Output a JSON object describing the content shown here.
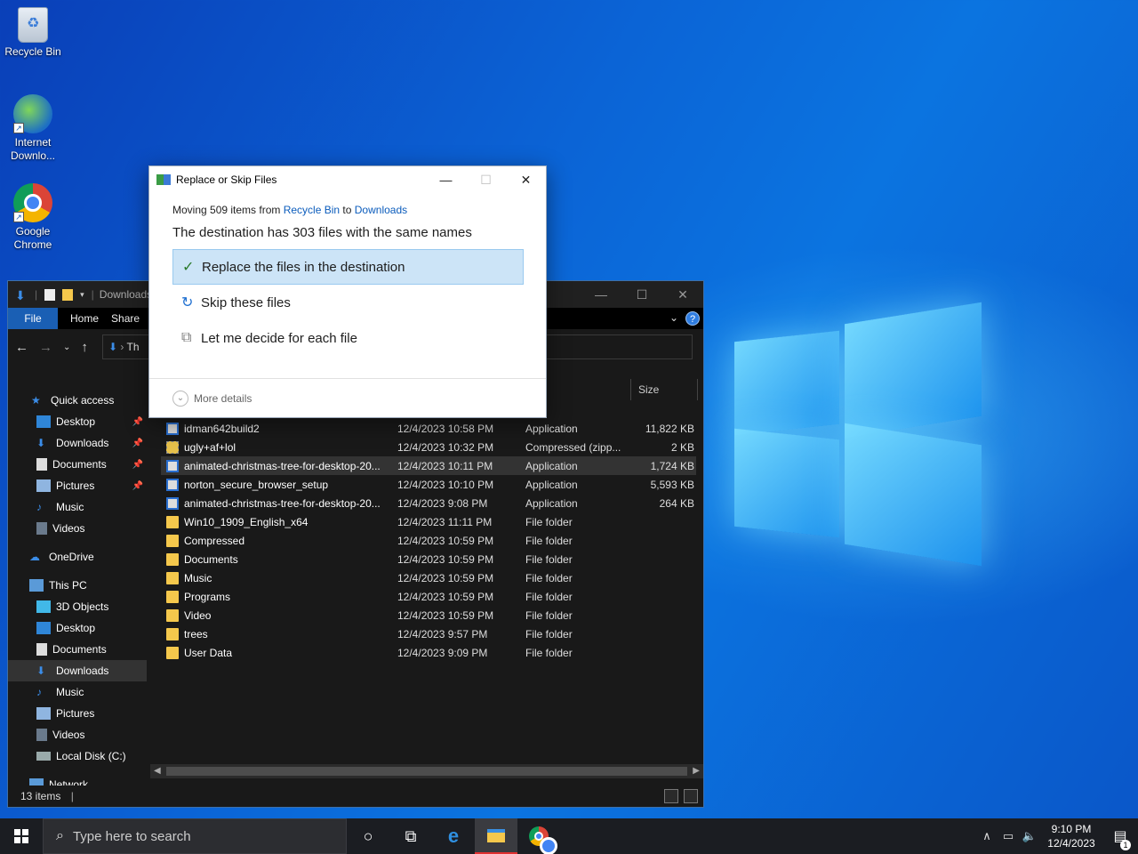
{
  "desktop": {
    "icons": [
      {
        "label": "Recycle Bin"
      },
      {
        "label": "Internet Downlo..."
      },
      {
        "label": "Google Chrome"
      }
    ]
  },
  "explorer": {
    "title": "Downloads",
    "ribbon": {
      "file": "File",
      "home": "Home",
      "share": "Share",
      "help": "?"
    },
    "address_partial": "Th",
    "column_size": "Size",
    "nav": [
      {
        "label": "Quick access"
      },
      {
        "label": "Desktop",
        "pinned": true
      },
      {
        "label": "Downloads",
        "pinned": true
      },
      {
        "label": "Documents",
        "pinned": true
      },
      {
        "label": "Pictures",
        "pinned": true
      },
      {
        "label": "Music"
      },
      {
        "label": "Videos"
      },
      {
        "label": "OneDrive"
      },
      {
        "label": "This PC"
      },
      {
        "label": "3D Objects"
      },
      {
        "label": "Desktop"
      },
      {
        "label": "Documents"
      },
      {
        "label": "Downloads"
      },
      {
        "label": "Music"
      },
      {
        "label": "Pictures"
      },
      {
        "label": "Videos"
      },
      {
        "label": "Local Disk (C:)"
      },
      {
        "label": "Network"
      }
    ],
    "files": [
      {
        "name": "idman642build2",
        "date": "12/4/2023 10:58 PM",
        "type": "Application",
        "size": "11,822 KB",
        "kind": "app"
      },
      {
        "name": "ugly+af+lol",
        "date": "12/4/2023 10:32 PM",
        "type": "Compressed (zipp...",
        "size": "2 KB",
        "kind": "zip"
      },
      {
        "name": "animated-christmas-tree-for-desktop-20...",
        "date": "12/4/2023 10:11 PM",
        "type": "Application",
        "size": "1,724 KB",
        "kind": "app"
      },
      {
        "name": "norton_secure_browser_setup",
        "date": "12/4/2023 10:10 PM",
        "type": "Application",
        "size": "5,593 KB",
        "kind": "app"
      },
      {
        "name": "animated-christmas-tree-for-desktop-20...",
        "date": "12/4/2023 9:08 PM",
        "type": "Application",
        "size": "264 KB",
        "kind": "app"
      },
      {
        "name": "Win10_1909_English_x64",
        "date": "12/4/2023 11:11 PM",
        "type": "File folder",
        "size": "",
        "kind": "folder"
      },
      {
        "name": "Compressed",
        "date": "12/4/2023 10:59 PM",
        "type": "File folder",
        "size": "",
        "kind": "folder"
      },
      {
        "name": "Documents",
        "date": "12/4/2023 10:59 PM",
        "type": "File folder",
        "size": "",
        "kind": "folder"
      },
      {
        "name": "Music",
        "date": "12/4/2023 10:59 PM",
        "type": "File folder",
        "size": "",
        "kind": "folder"
      },
      {
        "name": "Programs",
        "date": "12/4/2023 10:59 PM",
        "type": "File folder",
        "size": "",
        "kind": "folder"
      },
      {
        "name": "Video",
        "date": "12/4/2023 10:59 PM",
        "type": "File folder",
        "size": "",
        "kind": "folder"
      },
      {
        "name": "trees",
        "date": "12/4/2023 9:57 PM",
        "type": "File folder",
        "size": "",
        "kind": "folder"
      },
      {
        "name": "User Data",
        "date": "12/4/2023 9:09 PM",
        "type": "File folder",
        "size": "",
        "kind": "folder"
      }
    ],
    "status": "13 items"
  },
  "dialog": {
    "title": "Replace or Skip Files",
    "moving_prefix": "Moving 509 items from ",
    "source": "Recycle Bin",
    "to": " to ",
    "dest": "Downloads",
    "message": "The destination has 303 files with the same names",
    "options": [
      {
        "label": "Replace the files in the destination"
      },
      {
        "label": "Skip these files"
      },
      {
        "label": "Let me decide for each file"
      }
    ],
    "more_details": "More details"
  },
  "taskbar": {
    "search_placeholder": "Type here to search",
    "time": "9:10 PM",
    "date": "12/4/2023",
    "notification_count": "1"
  }
}
